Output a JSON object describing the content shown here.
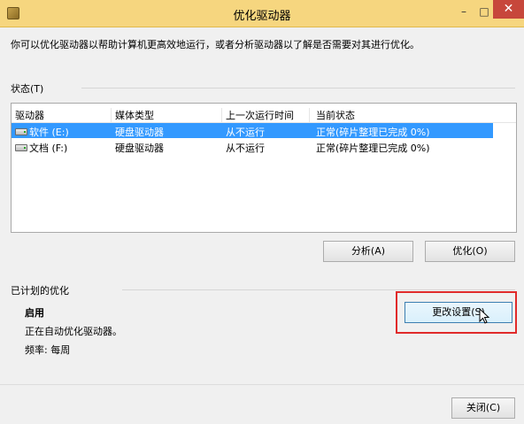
{
  "window": {
    "title": "优化驱动器",
    "min_label": "–",
    "max_label": "□",
    "close_label": "✕"
  },
  "description": "你可以优化驱动器以帮助计算机更高效地运行，或者分析驱动器以了解是否需要对其进行优化。",
  "status_section": {
    "label": "状态(T)"
  },
  "table": {
    "columns": [
      "驱动器",
      "媒体类型",
      "上一次运行时间",
      "当前状态"
    ],
    "rows": [
      {
        "drive": "软件 (E:)",
        "media": "硬盘驱动器",
        "last_run": "从不运行",
        "status": "正常(碎片整理已完成 0%)"
      },
      {
        "drive": "文档 (F:)",
        "media": "硬盘驱动器",
        "last_run": "从不运行",
        "status": "正常(碎片整理已完成 0%)"
      }
    ]
  },
  "buttons": {
    "analyze": "分析(A)",
    "optimize": "优化(O)",
    "change_settings": "更改设置(S)",
    "close": "关闭(C)"
  },
  "schedule_section": {
    "label": "已计划的优化",
    "state": "启用",
    "detail": "正在自动优化驱动器。",
    "frequency": "频率: 每周"
  },
  "colors": {
    "titlebar": "#f6d67f",
    "selection": "#3399ff",
    "highlight": "#e02a2a"
  }
}
